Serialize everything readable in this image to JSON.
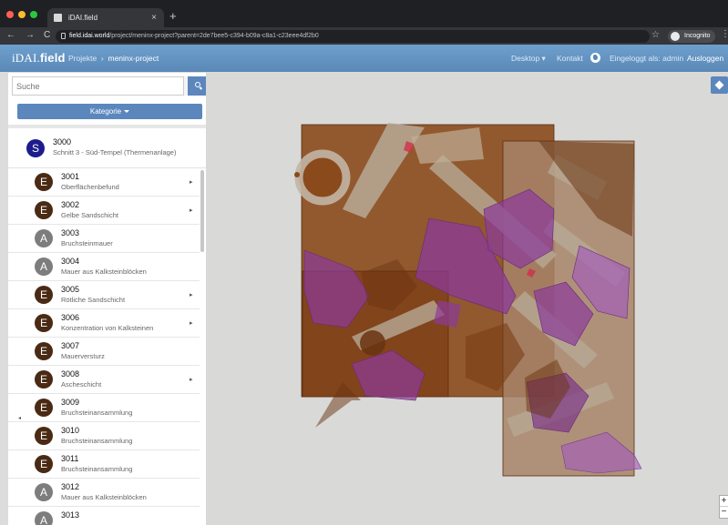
{
  "browser": {
    "tab_title": "iDAI.field",
    "tab_close": "×",
    "new_tab": "+",
    "url_host": "field.idai.world",
    "url_path": "/project/meninx-project?parent=2de7bee5-c394-b09a-c8a1-c23eee4df2b0",
    "incognito_label": "Incognito",
    "nav": {
      "back": "←",
      "forward": "→",
      "reload": "C",
      "bookmark": "☆",
      "menu": "⋮"
    },
    "traffic_colors": [
      "#ff5f57",
      "#febc2e",
      "#28c840"
    ]
  },
  "app": {
    "brand_prefix": "iDAI.",
    "brand_bold": "field",
    "breadcrumb": {
      "root": "Projekte",
      "separator": "›",
      "current": "meninx-project"
    },
    "menu_desktop": "Desktop",
    "menu_contact": "Kontakt",
    "login_status": "Eingeloggt als: admin",
    "logout": "Ausloggen"
  },
  "sidebar": {
    "search": {
      "placeholder": "Suche",
      "value": ""
    },
    "category_button": "Kategorie",
    "parent": {
      "letter": "S",
      "identifier": "3000",
      "short_description": "Schnitt 3 - Süd-Tempel (Thermenanlage)",
      "color": "#1c1c8c"
    },
    "collapse_arrow": "◂",
    "items": [
      {
        "letter": "E",
        "identifier": "3001",
        "short_description": "Oberflächenbefund",
        "color": "#4a2a14",
        "has_children": true
      },
      {
        "letter": "E",
        "identifier": "3002",
        "short_description": "Gelbe Sandschicht",
        "color": "#4a2a14",
        "has_children": true
      },
      {
        "letter": "A",
        "identifier": "3003",
        "short_description": "Bruchsteinmauer",
        "color": "#7d7d7d",
        "has_children": false
      },
      {
        "letter": "A",
        "identifier": "3004",
        "short_description": "Mauer aus Kalksteinblöcken",
        "color": "#7d7d7d",
        "has_children": false
      },
      {
        "letter": "E",
        "identifier": "3005",
        "short_description": "Rötliche Sandschicht",
        "color": "#4a2a14",
        "has_children": true
      },
      {
        "letter": "E",
        "identifier": "3006",
        "short_description": "Konzentration von Kalksteinen",
        "color": "#4a2a14",
        "has_children": true
      },
      {
        "letter": "E",
        "identifier": "3007",
        "short_description": "Mauerversturz",
        "color": "#4a2a14",
        "has_children": false
      },
      {
        "letter": "E",
        "identifier": "3008",
        "short_description": "Ascheschicht",
        "color": "#4a2a14",
        "has_children": true
      },
      {
        "letter": "E",
        "identifier": "3009",
        "short_description": "Bruchsteinansammlung",
        "color": "#4a2a14",
        "has_children": false
      },
      {
        "letter": "E",
        "identifier": "3010",
        "short_description": "Bruchsteinansammlung",
        "color": "#4a2a14",
        "has_children": false
      },
      {
        "letter": "E",
        "identifier": "3011",
        "short_description": "Bruchsteinansammlung",
        "color": "#4a2a14",
        "has_children": false
      },
      {
        "letter": "A",
        "identifier": "3012",
        "short_description": "Mauer aus Kalksteinblöcken",
        "color": "#7d7d7d",
        "has_children": false
      },
      {
        "letter": "A",
        "identifier": "3013",
        "short_description": "",
        "color": "#7d7d7d",
        "has_children": false
      }
    ]
  },
  "map": {
    "zoom_in": "+",
    "zoom_out": "−",
    "colors": {
      "feature_brown": "#8a4a1c",
      "feature_purple": "#8b3a9a",
      "wall_grey": "#a79a8a",
      "background": "#d9d9d8"
    }
  }
}
